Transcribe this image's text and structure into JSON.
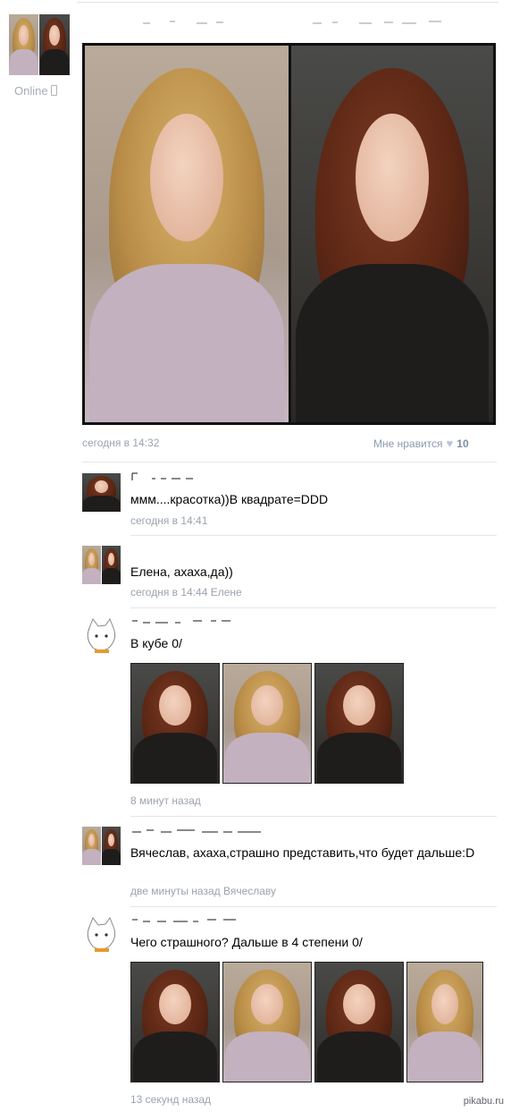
{
  "owner": {
    "status": "Online",
    "status_icon": "mobile-phone-icon"
  },
  "post": {
    "time": "сегодня в 14:32",
    "like_label": "Мне нравится",
    "like_icon": "heart-icon",
    "like_count": "10"
  },
  "comments": [
    {
      "text": "ммм....красотка))В квадрате=DDD",
      "time": "сегодня в 14:41",
      "thumbs": []
    },
    {
      "text": "Елена, ахаха,да))",
      "time": "сегодня в 14:44 Елене",
      "thumbs": []
    },
    {
      "text": "В кубе 0/",
      "time": "8 минут назад",
      "thumbs": [
        "brunette",
        "blonde",
        "brunette"
      ]
    },
    {
      "text": "Вячеслав, ахаха,страшно представить,что будет дальше:D",
      "time": "две минуты назад Вячеславу",
      "thumbs": []
    },
    {
      "text": "Чего страшного? Дальше в 4 степени 0/",
      "time": "13 секунд назад",
      "thumbs": [
        "brunette",
        "blonde",
        "brunette",
        "blonde"
      ]
    }
  ],
  "watermark": "pikabu.ru",
  "colors": {
    "meta": "#9ba3ad",
    "like": "#8a9bb0",
    "divider": "#e3e6ea"
  }
}
